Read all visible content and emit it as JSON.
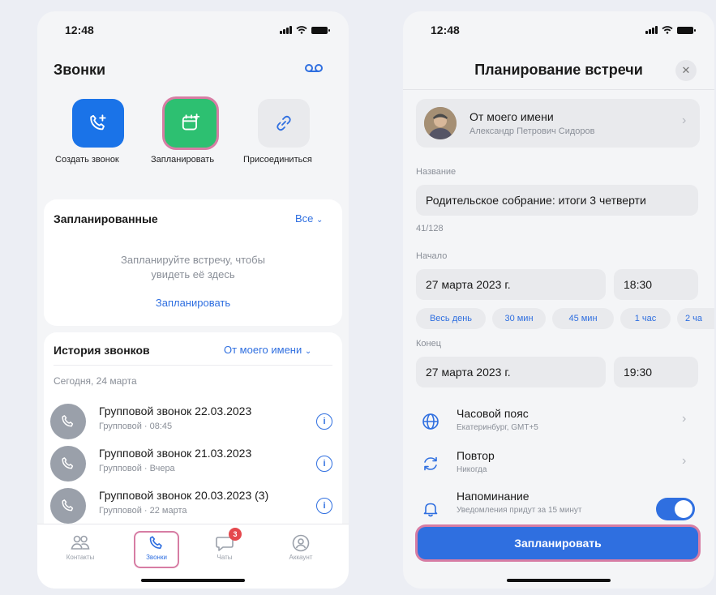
{
  "left": {
    "status_time": "12:48",
    "title": "Звонки",
    "tiles": [
      {
        "label": "Создать звонок",
        "color": "#1a73e8"
      },
      {
        "label": "Запланировать",
        "color": "#2dc071"
      },
      {
        "label": "Присоединиться",
        "color": "#e9eaed"
      }
    ],
    "scheduled": {
      "title": "Запланированные",
      "all_label": "Все",
      "empty_text_line1": "Запланируйте встречу, чтобы",
      "empty_text_line2": "увидеть её здесь",
      "schedule_link": "Запланировать"
    },
    "history": {
      "title": "История звонков",
      "filter_label": "От моего имени",
      "date_label": "Сегодня, 24 марта",
      "calls": [
        {
          "name": "Групповой звонок 22.03.2023",
          "sub": "Групповой · 08:45"
        },
        {
          "name": "Групповой звонок 21.03.2023",
          "sub": "Групповой · Вчера"
        },
        {
          "name": "Групповой звонок 20.03.2023 (3)",
          "sub": "Групповой · 22 марта"
        }
      ]
    },
    "tabbar": {
      "contacts": "Контакты",
      "calls": "Звонки",
      "chats": "Чаты",
      "chats_badge": "3",
      "account": "Аккаунт"
    },
    "highlight_color": "#d77da4"
  },
  "right": {
    "status_time": "12:48",
    "title": "Планирование встречи",
    "close_symbol": "✕",
    "organizer": {
      "title": "От моего имени",
      "name": "Александр Петрович Сидоров"
    },
    "name_label": "Название",
    "name_value": "Родительское собрание: итоги 3 четверти",
    "name_counter": "41/128",
    "start_label": "Начало",
    "start_date": "27 марта 2023 г.",
    "start_time": "18:30",
    "chips": [
      "Весь день",
      "30 мин",
      "45 мин",
      "1 час",
      "2 ча"
    ],
    "end_label": "Конец",
    "end_date": "27 марта 2023 г.",
    "end_time": "19:30",
    "timezone": {
      "title": "Часовой пояс",
      "sub": "Екатеринбург, GMT+5"
    },
    "repeat": {
      "title": "Повтор",
      "sub": "Никогда"
    },
    "reminder": {
      "title": "Напоминание",
      "sub": "Уведомления придут за 15 минут",
      "enabled": true
    },
    "cta_label": "Запланировать",
    "accent_color": "#2f6fe0"
  }
}
